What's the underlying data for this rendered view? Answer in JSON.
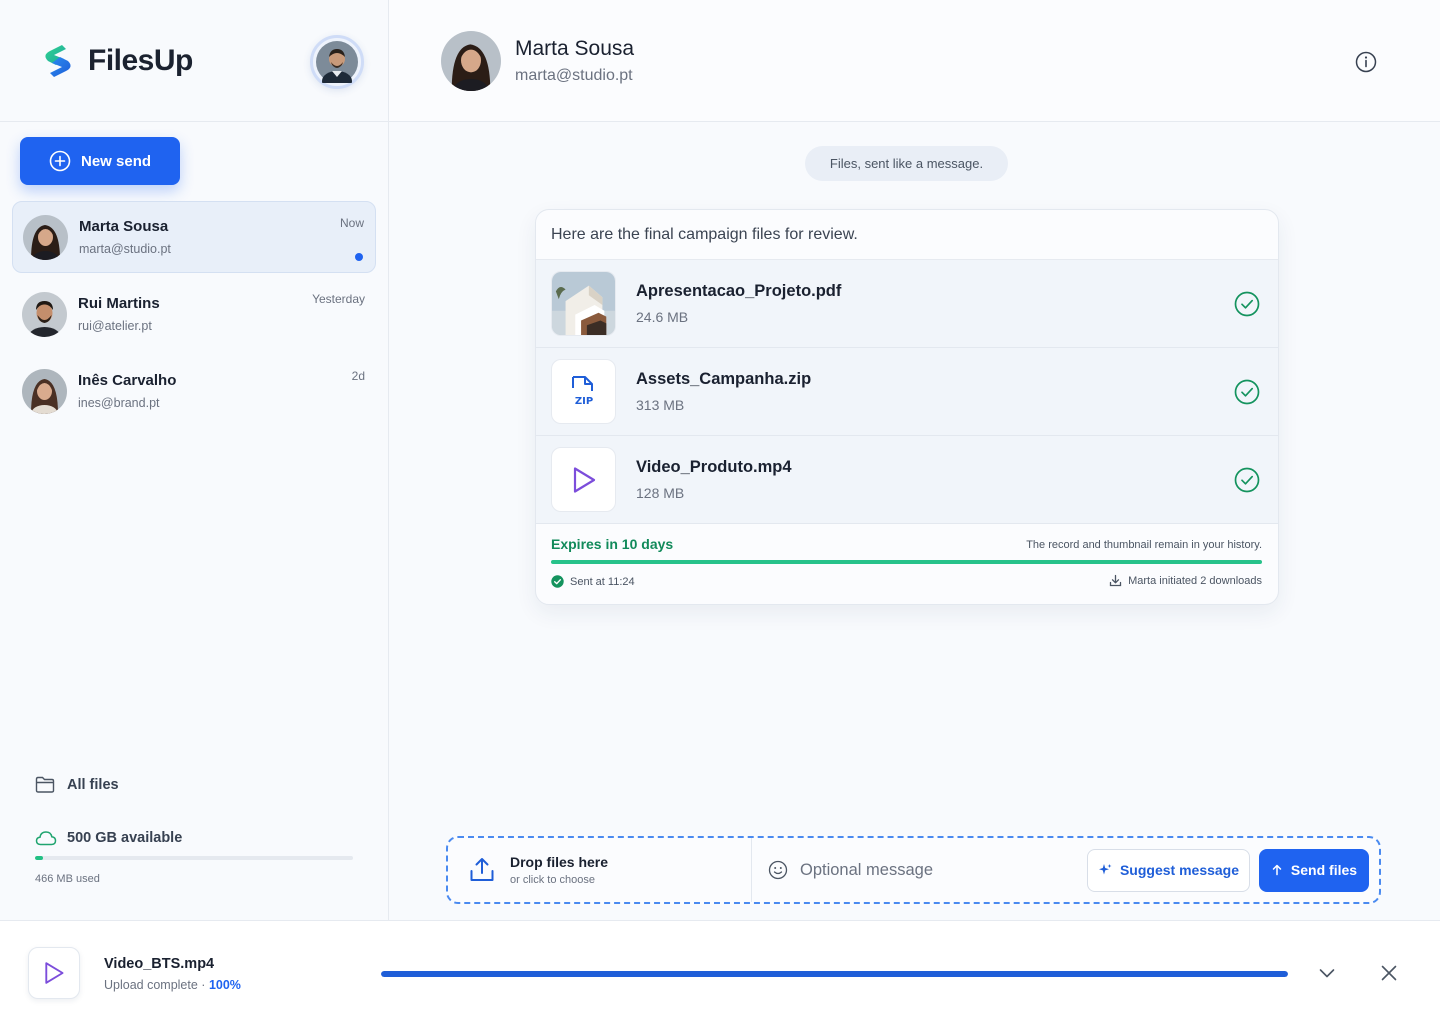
{
  "app": {
    "name": "FilesUp",
    "brand_color": "#1f63f0",
    "accent_green": "#22c084"
  },
  "sidebar": {
    "new_send_label": "New send",
    "contacts": [
      {
        "name": "Marta Sousa",
        "email": "marta@studio.pt",
        "time": "Now",
        "unread": true,
        "active": true
      },
      {
        "name": "Rui Martins",
        "email": "rui@atelier.pt",
        "time": "Yesterday",
        "unread": false,
        "active": false
      },
      {
        "name": "Inês Carvalho",
        "email": "ines@brand.pt",
        "time": "2d",
        "unread": false,
        "active": false
      }
    ],
    "all_files_label": "All files",
    "storage": {
      "available_label": "500 GB available",
      "used_label": "466 MB used",
      "used_fraction": 0.025
    }
  },
  "chat": {
    "contact_name": "Marta Sousa",
    "contact_email": "marta@studio.pt",
    "tagline": "Files, sent like a message.",
    "message": "Here are the final campaign files for review.",
    "files": [
      {
        "name": "Apresentacao_Projeto.pdf",
        "size": "24.6 MB",
        "icon": "image-thumbnail",
        "status": "check-circle-icon"
      },
      {
        "name": "Assets_Campanha.zip",
        "size": "313 MB",
        "icon": "zip-icon",
        "zip_label": "ZIP",
        "status": "check-circle-icon"
      },
      {
        "name": "Video_Produto.mp4",
        "size": "128 MB",
        "icon": "play-icon",
        "status": "check-circle-icon"
      }
    ],
    "expires_label": "Expires in 10 days",
    "history_note": "The record and thumbnail remain in your history.",
    "sent_at": "Sent at 11:24",
    "downloads_note": "Marta initiated 2 downloads",
    "expiry_remaining_fraction": 1.0
  },
  "composer": {
    "drop_title": "Drop files here",
    "drop_sub": "or click to choose",
    "message_placeholder": "Optional message",
    "suggest_label": "Suggest message",
    "send_label": "Send files"
  },
  "upload": {
    "file_name": "Video_BTS.mp4",
    "status_text": "Upload complete ·",
    "percent_label": "100%",
    "progress_fraction": 1.0
  }
}
